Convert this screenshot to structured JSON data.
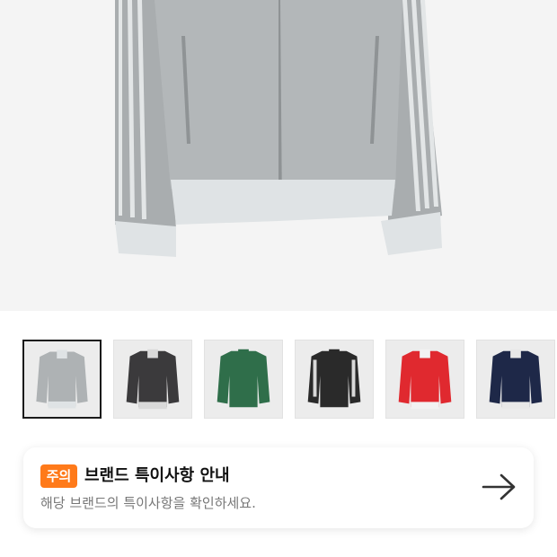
{
  "product_image": {
    "icon": "gray-track-jacket-image"
  },
  "thumbnails": [
    {
      "color": "#aeb2b4",
      "trim": "#dfe3e5",
      "stripe": "#e8ebec",
      "selected": true
    },
    {
      "color": "#3b3a3c",
      "trim": "#d9d9d9",
      "stripe": "#d9d9d9",
      "selected": false
    },
    {
      "color": "#2f6e4a",
      "trim": "#2f6e4a",
      "stripe": "#e6e6e6",
      "selected": false
    },
    {
      "color": "#2a2a2a",
      "trim": "#2a2a2a",
      "stripe": "#d9d9d9",
      "selected": false
    },
    {
      "color": "#e0292f",
      "trim": "#e0292f",
      "stripe": "#f2f2f2",
      "selected": false
    },
    {
      "color": "#1e2848",
      "trim": "#e8e8e8",
      "stripe": "#f0f0f0",
      "selected": false
    }
  ],
  "notice": {
    "badge": "주의",
    "title": "브랜드 특이사항 안내",
    "subtitle": "해당 브랜드의 특이사항을 확인하세요.",
    "badge_color": "#ff7a1a",
    "icon": "arrow-right-icon"
  }
}
